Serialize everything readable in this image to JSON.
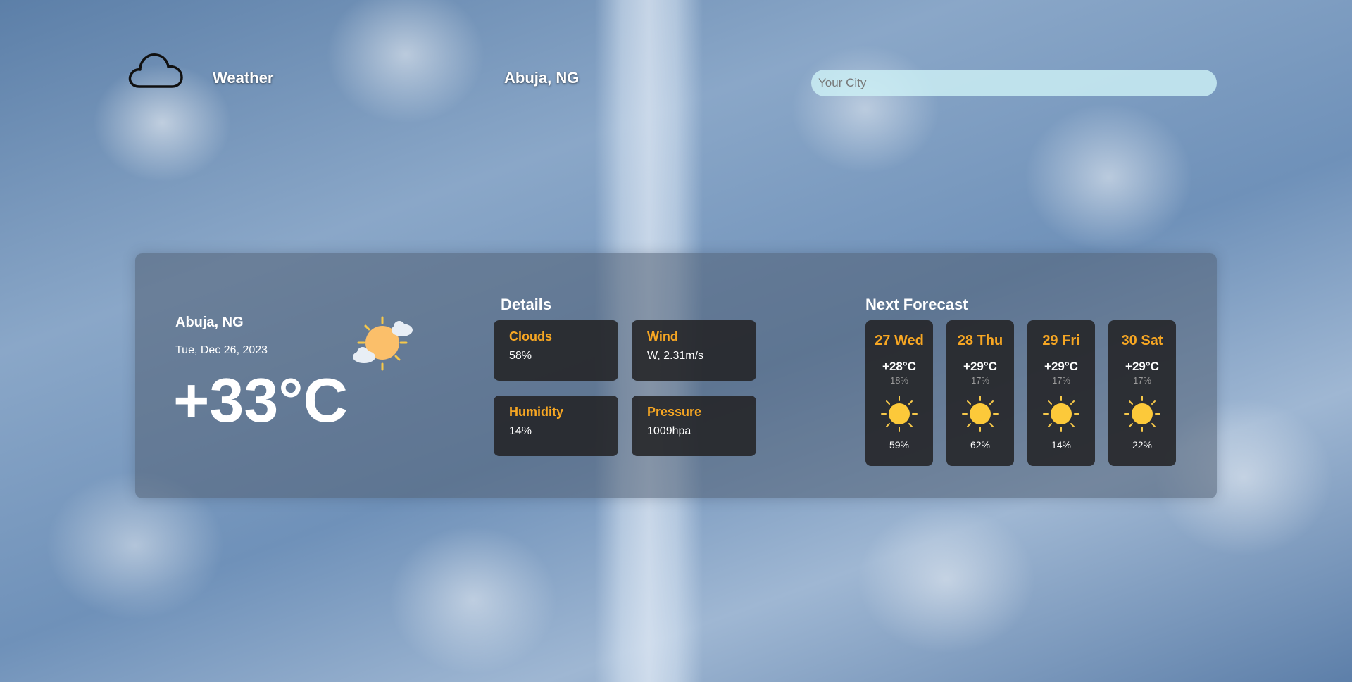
{
  "header": {
    "logo_icon": "cloud-icon",
    "app_title": "Weather",
    "city": "Abuja, NG",
    "search_placeholder": "Your City"
  },
  "current": {
    "city": "Abuja, NG",
    "date": "Tue, Dec 26, 2023",
    "temperature": "+33°C",
    "icon": "sun-with-clouds-icon"
  },
  "details": {
    "title": "Details",
    "cards": [
      {
        "label": "Clouds",
        "value": "58%"
      },
      {
        "label": "Wind",
        "value": "W, 2.31m/s"
      },
      {
        "label": "Humidity",
        "value": "14%"
      },
      {
        "label": "Pressure",
        "value": "1009hpa"
      }
    ]
  },
  "forecast": {
    "title": "Next Forecast",
    "days": [
      {
        "day": "27 Wed",
        "temp": "+28°C",
        "low": "18%",
        "icon": "sun-icon",
        "pct": "59%"
      },
      {
        "day": "28 Thu",
        "temp": "+29°C",
        "low": "17%",
        "icon": "sun-icon",
        "pct": "62%"
      },
      {
        "day": "29 Fri",
        "temp": "+29°C",
        "low": "17%",
        "icon": "sun-icon",
        "pct": "14%"
      },
      {
        "day": "30 Sat",
        "temp": "+29°C",
        "low": "17%",
        "icon": "sun-icon",
        "pct": "22%"
      }
    ]
  },
  "colors": {
    "accent": "#f6a623",
    "card_bg": "#232326",
    "search_bg": "#cdf0f5"
  }
}
